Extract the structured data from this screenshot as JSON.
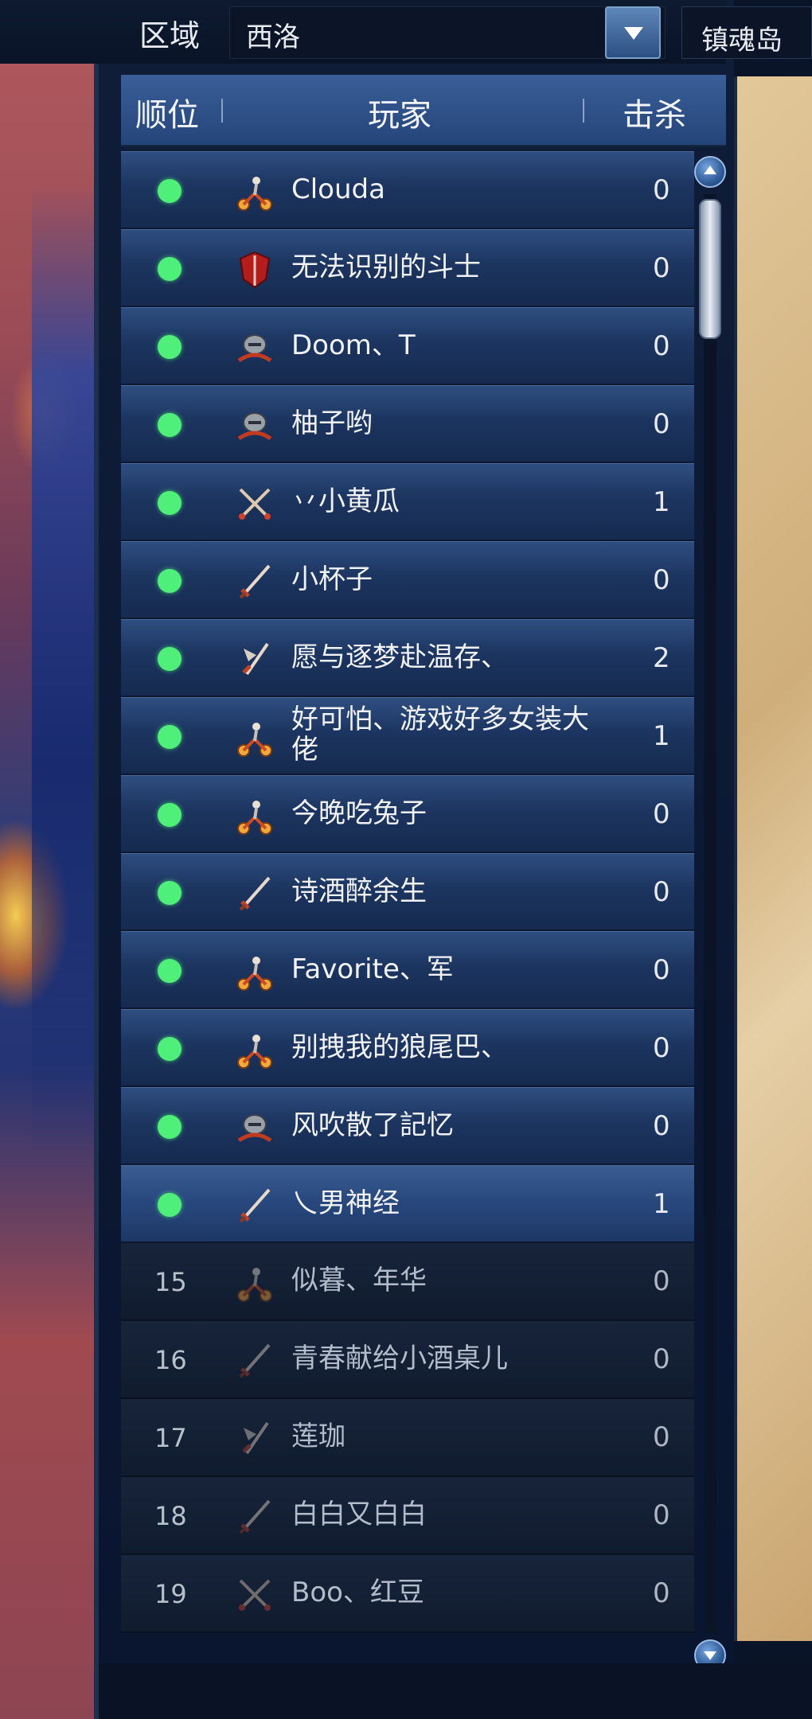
{
  "filter": {
    "region_label": "区域",
    "region_value": "西洛",
    "zone_tab": "镇魂岛"
  },
  "table": {
    "headers": {
      "rank": "顺位",
      "player": "玩家",
      "kills": "击杀"
    },
    "rows": [
      {
        "rank": "",
        "name": "Clouda",
        "kills": "0",
        "status": "online",
        "icon": "bike-rider-icon"
      },
      {
        "rank": "",
        "name": "无法识别的斗士",
        "kills": "0",
        "status": "online",
        "icon": "red-shield-icon"
      },
      {
        "rank": "",
        "name": "Doom、T",
        "kills": "0",
        "status": "online",
        "icon": "armored-helmet-icon"
      },
      {
        "rank": "",
        "name": "柚子哟",
        "kills": "0",
        "status": "online",
        "icon": "armored-helmet-icon"
      },
      {
        "rank": "",
        "name": "丷小黄瓜",
        "kills": "1",
        "status": "online",
        "icon": "crossed-swords-icon"
      },
      {
        "rank": "",
        "name": "小杯子",
        "kills": "0",
        "status": "online",
        "icon": "sword-icon"
      },
      {
        "rank": "",
        "name": "愿与逐梦赴温存、",
        "kills": "2",
        "status": "online",
        "icon": "winged-blade-icon"
      },
      {
        "rank": "",
        "name": "好可怕、游戏好多女装大佬",
        "kills": "1",
        "status": "online",
        "icon": "bike-rider-icon"
      },
      {
        "rank": "",
        "name": "今晚吃兔子",
        "kills": "0",
        "status": "online",
        "icon": "bike-rider-icon"
      },
      {
        "rank": "",
        "name": "诗酒醉余生",
        "kills": "0",
        "status": "online",
        "icon": "sword-icon"
      },
      {
        "rank": "",
        "name": "Favorite、军",
        "kills": "0",
        "status": "online",
        "icon": "bike-rider-icon"
      },
      {
        "rank": "",
        "name": "别拽我的狼尾巴、",
        "kills": "0",
        "status": "online",
        "icon": "bike-rider-icon"
      },
      {
        "rank": "",
        "name": "风吹散了記忆",
        "kills": "0",
        "status": "online",
        "icon": "armored-helmet-icon"
      },
      {
        "rank": "",
        "name": "乀男神经",
        "kills": "1",
        "status": "online",
        "icon": "sword-icon"
      },
      {
        "rank": "15",
        "name": "似暮、年华",
        "kills": "0",
        "status": "offline",
        "icon": "bike-rider-icon"
      },
      {
        "rank": "16",
        "name": "青春献给小酒桌儿",
        "kills": "0",
        "status": "offline",
        "icon": "sword-icon"
      },
      {
        "rank": "17",
        "name": "莲珈",
        "kills": "0",
        "status": "offline",
        "icon": "winged-blade-icon"
      },
      {
        "rank": "18",
        "name": "白白又白白",
        "kills": "0",
        "status": "offline",
        "icon": "sword-icon"
      },
      {
        "rank": "19",
        "name": "Boo、红豆",
        "kills": "0",
        "status": "offline",
        "icon": "crossed-swords-icon"
      }
    ]
  },
  "colors": {
    "online_dot": "#4ef07a",
    "header_bg": "#2e5088",
    "row_online": "#1f3a66",
    "row_offline": "#131f33"
  }
}
